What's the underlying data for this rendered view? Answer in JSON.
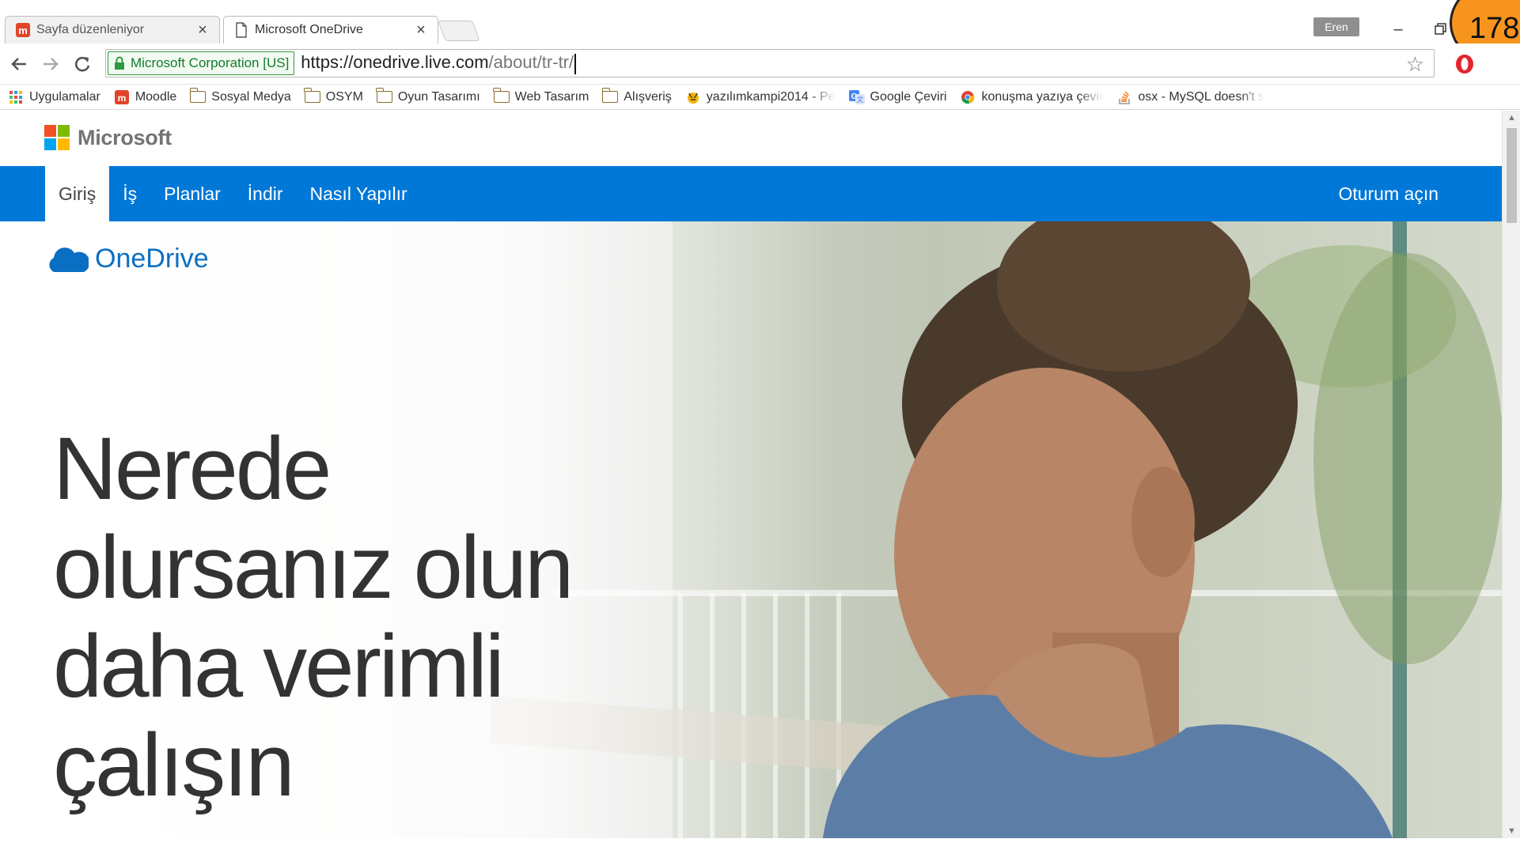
{
  "browser": {
    "tabs": [
      {
        "title": "Sayfa düzenleniyor",
        "icon": "moodle-icon"
      },
      {
        "title": "Microsoft OneDrive",
        "icon": "page-icon"
      }
    ],
    "profile_name": "Eren",
    "overlay_counter": "178",
    "security_chip": "Microsoft Corporation [US]",
    "url_base": "https://onedrive.live.com",
    "url_path": "/about/tr-tr/",
    "bookmarks": [
      {
        "label": "Uygulamalar",
        "icon": "apps-grid-icon"
      },
      {
        "label": "Moodle",
        "icon": "moodle-icon"
      },
      {
        "label": "Sosyal Medya",
        "icon": "folder-icon"
      },
      {
        "label": "OSYM",
        "icon": "folder-icon"
      },
      {
        "label": "Oyun Tasarımı",
        "icon": "folder-icon"
      },
      {
        "label": "Web Tasarım",
        "icon": "folder-icon"
      },
      {
        "label": "Alışveriş",
        "icon": "folder-icon"
      },
      {
        "label": "yazılımkampi2014 - Pe",
        "icon": "tiger-icon"
      },
      {
        "label": "Google Çeviri",
        "icon": "google-translate-icon"
      },
      {
        "label": "konuşma yazıya çevir",
        "icon": "chrome-icon"
      },
      {
        "label": "osx - MySQL doesn't s",
        "icon": "stackoverflow-icon"
      }
    ]
  },
  "page": {
    "ms_logo_text": "Microsoft",
    "nav": {
      "items": [
        "Giriş",
        "İş",
        "Planlar",
        "İndir",
        "Nasıl Yapılır"
      ],
      "active_index": 0,
      "signin": "Oturum açın"
    },
    "brand": "OneDrive",
    "headline_lines": [
      "Nerede",
      "olursanız olun",
      "daha verimli",
      "çalışın"
    ]
  },
  "colors": {
    "nav_blue": "#0078d7",
    "onedrive_blue": "#0a6fc2",
    "ev_green": "#137b2a",
    "ms_red": "#f25022",
    "ms_green": "#7fba00",
    "ms_blue": "#00a4ef",
    "ms_yellow": "#ffb900"
  }
}
